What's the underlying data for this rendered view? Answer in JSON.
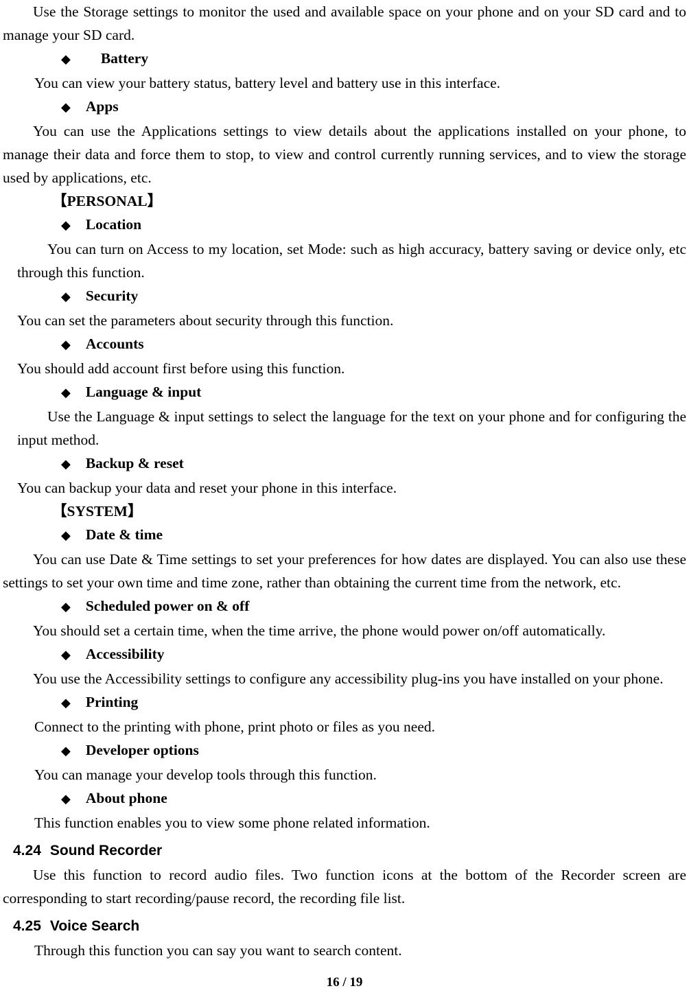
{
  "document": {
    "page_footer": "16 / 19",
    "bullet_glyph": "◆",
    "bracket_open": "【",
    "bracket_close": "】"
  },
  "intro": {
    "storage_paragraph": "Use the Storage settings to monitor the used and available space on your phone and on your SD card and to manage your SD card."
  },
  "entries": {
    "battery": {
      "title": "Battery",
      "body": "You can view your battery status, battery level and battery use in this interface."
    },
    "apps": {
      "title": "Apps",
      "body": "You can use the Applications settings to view details about the applications installed on your phone, to manage their data and force them to stop, to view and control currently running services, and to view the storage used by applications, etc."
    },
    "location": {
      "title": "Location",
      "body": "You can turn on Access to my location, set Mode: such as high accuracy, battery saving or device only, etc through this function."
    },
    "security": {
      "title": "Security",
      "body": "You can set the parameters about security through this function."
    },
    "accounts": {
      "title": "Accounts",
      "body": "You should add account first before using this function."
    },
    "language_input": {
      "title": "Language & input",
      "body": "Use the Language & input settings to select the language for the text on your phone and for configuring the input method."
    },
    "backup_reset": {
      "title": "Backup & reset",
      "body": "You can backup your data and reset your phone in this interface."
    },
    "date_time": {
      "title": "Date & time",
      "body": "You can use Date & Time settings to set your preferences for how dates are displayed. You can also use these settings to set your own time and time zone, rather than obtaining the current time from the network, etc."
    },
    "scheduled_power": {
      "title": "Scheduled power on & off",
      "body": "You should set a certain time, when the time arrive, the phone would power on/off automatically."
    },
    "accessibility": {
      "title": "Accessibility",
      "body": "You use the Accessibility settings to configure any accessibility plug-ins you have installed on your phone."
    },
    "printing": {
      "title": "Printing",
      "body": "Connect to the printing with phone, print photo or files as you need."
    },
    "developer_options": {
      "title": "Developer options",
      "body": "You can manage your develop tools through this function."
    },
    "about_phone": {
      "title": "About phone",
      "body": "This function enables you to view some phone related information."
    }
  },
  "groups": {
    "personal": "PERSONAL",
    "system": "SYSTEM"
  },
  "sections": {
    "sound_recorder": {
      "number": "4.24",
      "title": "Sound Recorder",
      "body": "Use this function to record audio files. Two function icons at the bottom of the Recorder screen are corresponding to start recording/pause record, the recording file list."
    },
    "voice_search": {
      "number": "4.25",
      "title": "Voice Search",
      "body": "Through this function you can say you want to search content."
    }
  }
}
